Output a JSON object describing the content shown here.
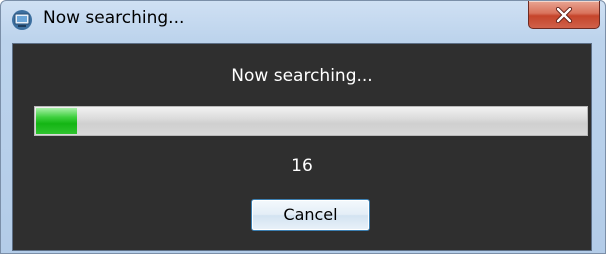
{
  "window": {
    "title": "Now searching...",
    "icon": "monitor-app-icon",
    "close_icon": "close-x-icon"
  },
  "dialog": {
    "message": "Now searching...",
    "progress_fraction": 0.075,
    "count": "16",
    "cancel_label": "Cancel"
  },
  "colors": {
    "client_background": "#2f2f2f",
    "progress_fill": "#22bb22",
    "close_button": "#c5452b"
  }
}
